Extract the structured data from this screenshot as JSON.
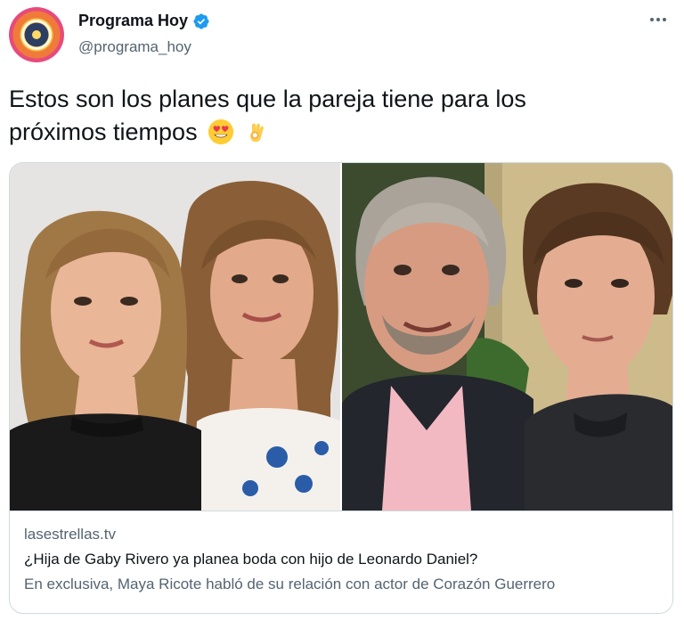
{
  "account": {
    "display_name": "Programa Hoy",
    "handle": "@programa_hoy",
    "verified": true
  },
  "tweet": {
    "text_line1": "Estos son los planes que la pareja tiene para los",
    "text_line2": "próximos tiempos",
    "emojis": [
      "heart-eyes-emoji",
      "ok-hand-emoji"
    ]
  },
  "card": {
    "domain": "lasestrellas.tv",
    "title": "¿Hija de Gaby Rivero ya planea boda con hijo de Leonardo Daniel?",
    "description": "En exclusiva, Maya Ricote habló de su relación con actor de Corazón Guerrero"
  },
  "colors": {
    "text_primary": "#0f1419",
    "text_secondary": "#536471",
    "verified_blue": "#1d9bf0",
    "border": "#cfd9de"
  }
}
